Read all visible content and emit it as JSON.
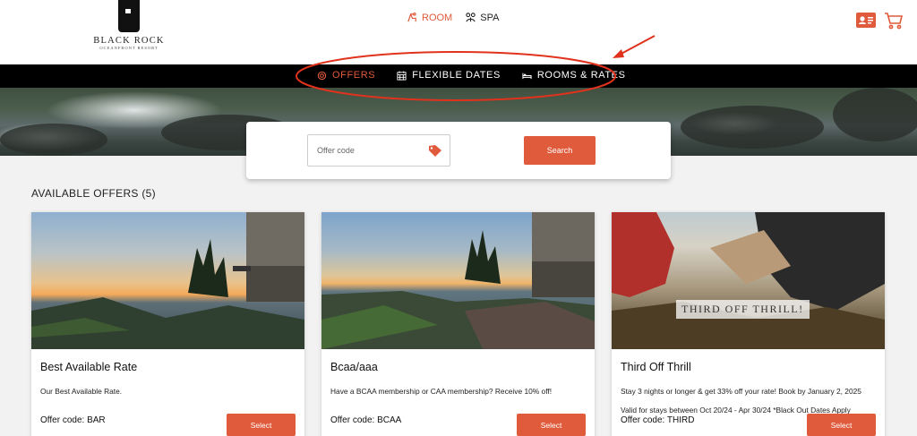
{
  "brand": {
    "name": "BLACK ROCK",
    "tagline": "OCEANFRONT RESORT"
  },
  "top_nav": {
    "room_label": "ROOM",
    "spa_label": "SPA"
  },
  "sub_nav": {
    "offers_label": "OFFERS",
    "flexible_dates_label": "FLEXIBLE DATES",
    "rooms_rates_label": "ROOMS & RATES"
  },
  "search": {
    "placeholder": "Offer code",
    "button_label": "Search"
  },
  "offers": {
    "heading": "AVAILABLE OFFERS (5)",
    "items": [
      {
        "title": "Best Available Rate",
        "description": "Our Best Available Rate.",
        "note": "",
        "code": "Offer code: BAR",
        "button": "Select"
      },
      {
        "title": "Bcaa/aaa",
        "description": "Have a BCAA membership or CAA membership? Receive 10% off!",
        "note": "",
        "code": "Offer code: BCAA",
        "button": "Select"
      },
      {
        "title": "Third Off Thrill",
        "description": "Stay 3 nights or longer & get 33% off your rate! Book by January 2, 2025",
        "note": "Valid for stays between Oct 20/24 - Apr 30/24 *Black Out Dates Apply",
        "code": "Offer code: THIRD",
        "button": "Select",
        "image_label": "THIRD OFF THRILL!"
      }
    ]
  },
  "colors": {
    "accent": "#e05a3c",
    "nav_bar": "#000000",
    "annotation": "#e0321c"
  },
  "icons": [
    "room-icon",
    "spa-icon",
    "account-card-icon",
    "cart-icon",
    "offers-icon",
    "calendar-icon",
    "bed-icon",
    "tag-icon"
  ]
}
